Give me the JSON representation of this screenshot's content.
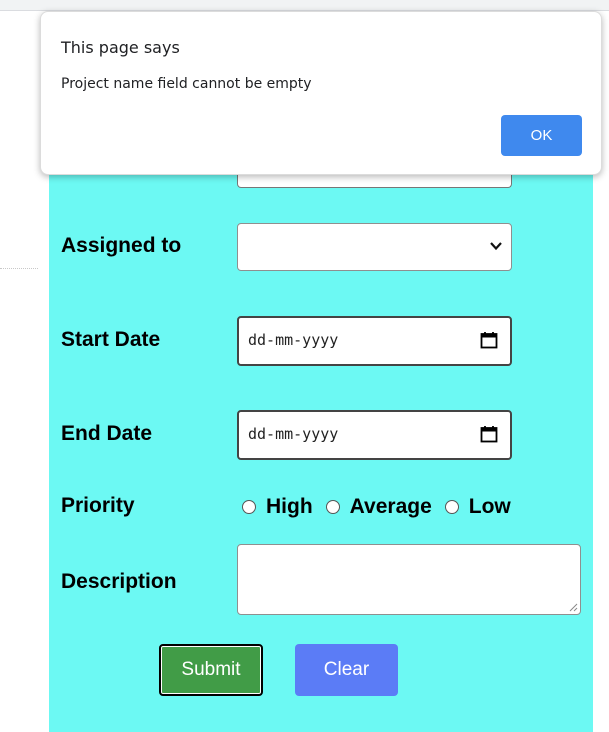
{
  "dialog": {
    "title": "This page says",
    "message": "Project name field cannot be empty",
    "ok_label": "OK"
  },
  "form": {
    "assigned_label": "Assigned to",
    "assigned_value": "",
    "start_label": "Start Date",
    "start_placeholder": "dd-mm-yyyy",
    "end_label": "End Date",
    "end_placeholder": "dd-mm-yyyy",
    "priority_label": "Priority",
    "priority_options": [
      "High",
      "Average",
      "Low"
    ],
    "description_label": "Description",
    "submit_label": "Submit",
    "clear_label": "Clear"
  },
  "colors": {
    "panel_bg": "#6cf9f3",
    "submit_bg": "#419c47",
    "clear_bg": "#5b7cf6",
    "ok_bg": "#3f89ee"
  }
}
